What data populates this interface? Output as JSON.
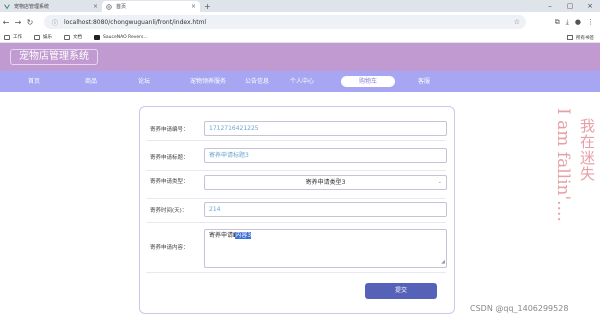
{
  "browser": {
    "tabs": [
      {
        "title": "宠物店管理系统",
        "active": false
      },
      {
        "title": "首页",
        "active": true
      }
    ],
    "new_tab": "+",
    "url": "localhost:8080/chongwuguanli/front/index.html",
    "bookmarks": [
      "工作",
      "娱乐",
      "文档",
      "SauceNAO Revers..."
    ],
    "bookmarks_right": "所有书签"
  },
  "header": {
    "brand": "宠物店管理系统"
  },
  "nav": {
    "items": [
      "首页",
      "商品",
      "论坛",
      "宠物领养服务",
      "公告信息",
      "个人中心",
      "购物车",
      "客服"
    ],
    "active": "购物车"
  },
  "form": {
    "fields": [
      {
        "label": "寄养申请编号：",
        "value": "1712716421225"
      },
      {
        "label": "寄养申请标题：",
        "placeholder": "寄养申请标题3"
      },
      {
        "label": "寄养申请类型：",
        "value": "寄养申请类型3"
      },
      {
        "label": "寄养时间(天)：",
        "value": "214"
      },
      {
        "label": "寄养申请内容：",
        "value_prefix": "寄养申请",
        "value_selected": "内容3"
      }
    ],
    "submit_label": "提交"
  },
  "side": {
    "line1": "我在迷失",
    "line2": "I am fallin'...."
  },
  "watermark": "CSDN @qq_1406299528"
}
